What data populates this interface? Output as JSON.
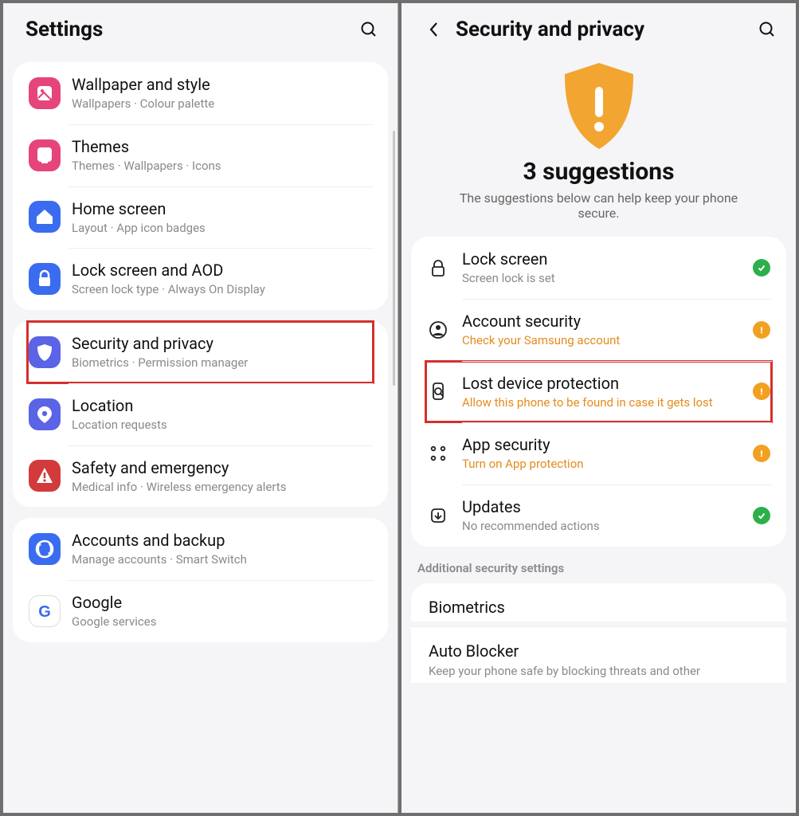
{
  "left": {
    "title": "Settings",
    "items": [
      {
        "name": "wallpaper",
        "label": "Wallpaper and style",
        "sub": "Wallpapers  ·  Colour palette",
        "bg": "#e5457a"
      },
      {
        "name": "themes",
        "label": "Themes",
        "sub": "Themes  ·  Wallpapers  ·  Icons",
        "bg": "#e5457a"
      },
      {
        "name": "home",
        "label": "Home screen",
        "sub": "Layout  ·  App icon badges",
        "bg": "#3a6cf0"
      },
      {
        "name": "lockscreen",
        "label": "Lock screen and AOD",
        "sub": "Screen lock type  ·  Always On Display",
        "bg": "#3a6cf0"
      },
      {
        "name": "security",
        "label": "Security and privacy",
        "sub": "Biometrics  ·  Permission manager",
        "bg": "#5b63e6",
        "hl": true
      },
      {
        "name": "location",
        "label": "Location",
        "sub": "Location requests",
        "bg": "#5b63e6"
      },
      {
        "name": "safety",
        "label": "Safety and emergency",
        "sub": "Medical info  ·  Wireless emergency alerts",
        "bg": "#d23b3b"
      },
      {
        "name": "accounts",
        "label": "Accounts and backup",
        "sub": "Manage accounts  ·  Smart Switch",
        "bg": "#3a6cf0"
      },
      {
        "name": "google",
        "label": "Google",
        "sub": "Google services",
        "bg": "#ffffff"
      }
    ]
  },
  "right": {
    "title": "Security and privacy",
    "hero_title": "3 suggestions",
    "hero_sub": "The suggestions below can help keep your phone secure.",
    "suggestions": [
      {
        "name": "lockscreen",
        "label": "Lock screen",
        "sub": "Screen lock is set",
        "status": "ok"
      },
      {
        "name": "account",
        "label": "Account security",
        "sub": "Check your Samsung account",
        "status": "warn",
        "warn": true
      },
      {
        "name": "lost",
        "label": "Lost device protection",
        "sub": "Allow this phone to be found in case it gets lost",
        "status": "warn",
        "warn": true,
        "hl": true
      },
      {
        "name": "appsec",
        "label": "App security",
        "sub": "Turn on App protection",
        "status": "warn",
        "warn": true
      },
      {
        "name": "updates",
        "label": "Updates",
        "sub": "No recommended actions",
        "status": "ok"
      }
    ],
    "section_label": "Additional security settings",
    "extras": [
      {
        "name": "biometrics",
        "label": "Biometrics",
        "sub": ""
      },
      {
        "name": "autoblocker",
        "label": "Auto Blocker",
        "sub": "Keep your phone safe by blocking threats and other"
      }
    ]
  }
}
